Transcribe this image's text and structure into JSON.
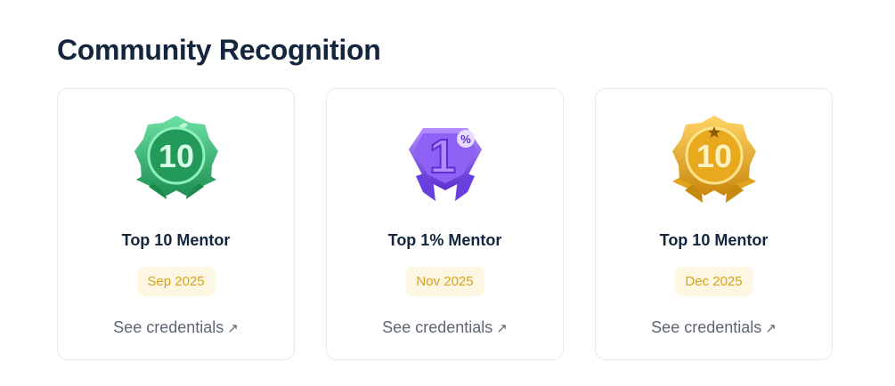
{
  "section": {
    "title": "Community Recognition"
  },
  "cards": [
    {
      "title": "Top 10 Mentor",
      "date": "Sep 2025",
      "link": "See credentials",
      "badge_icon": "green-top-10-badge-icon",
      "badge_text": "10"
    },
    {
      "title": "Top 1% Mentor",
      "date": "Nov 2025",
      "link": "See credentials",
      "badge_icon": "purple-top-1-percent-badge-icon",
      "badge_text": "1"
    },
    {
      "title": "Top 10 Mentor",
      "date": "Dec 2025",
      "link": "See credentials",
      "badge_icon": "gold-top-10-badge-icon",
      "badge_text": "10"
    }
  ],
  "colors": {
    "heading": "#13263d",
    "pill_bg": "#fdf6e2",
    "pill_text": "#d8a21a",
    "link": "#5d6673",
    "green": "#2fae6a",
    "purple": "#7b4fe0",
    "gold": "#e0a51c"
  }
}
